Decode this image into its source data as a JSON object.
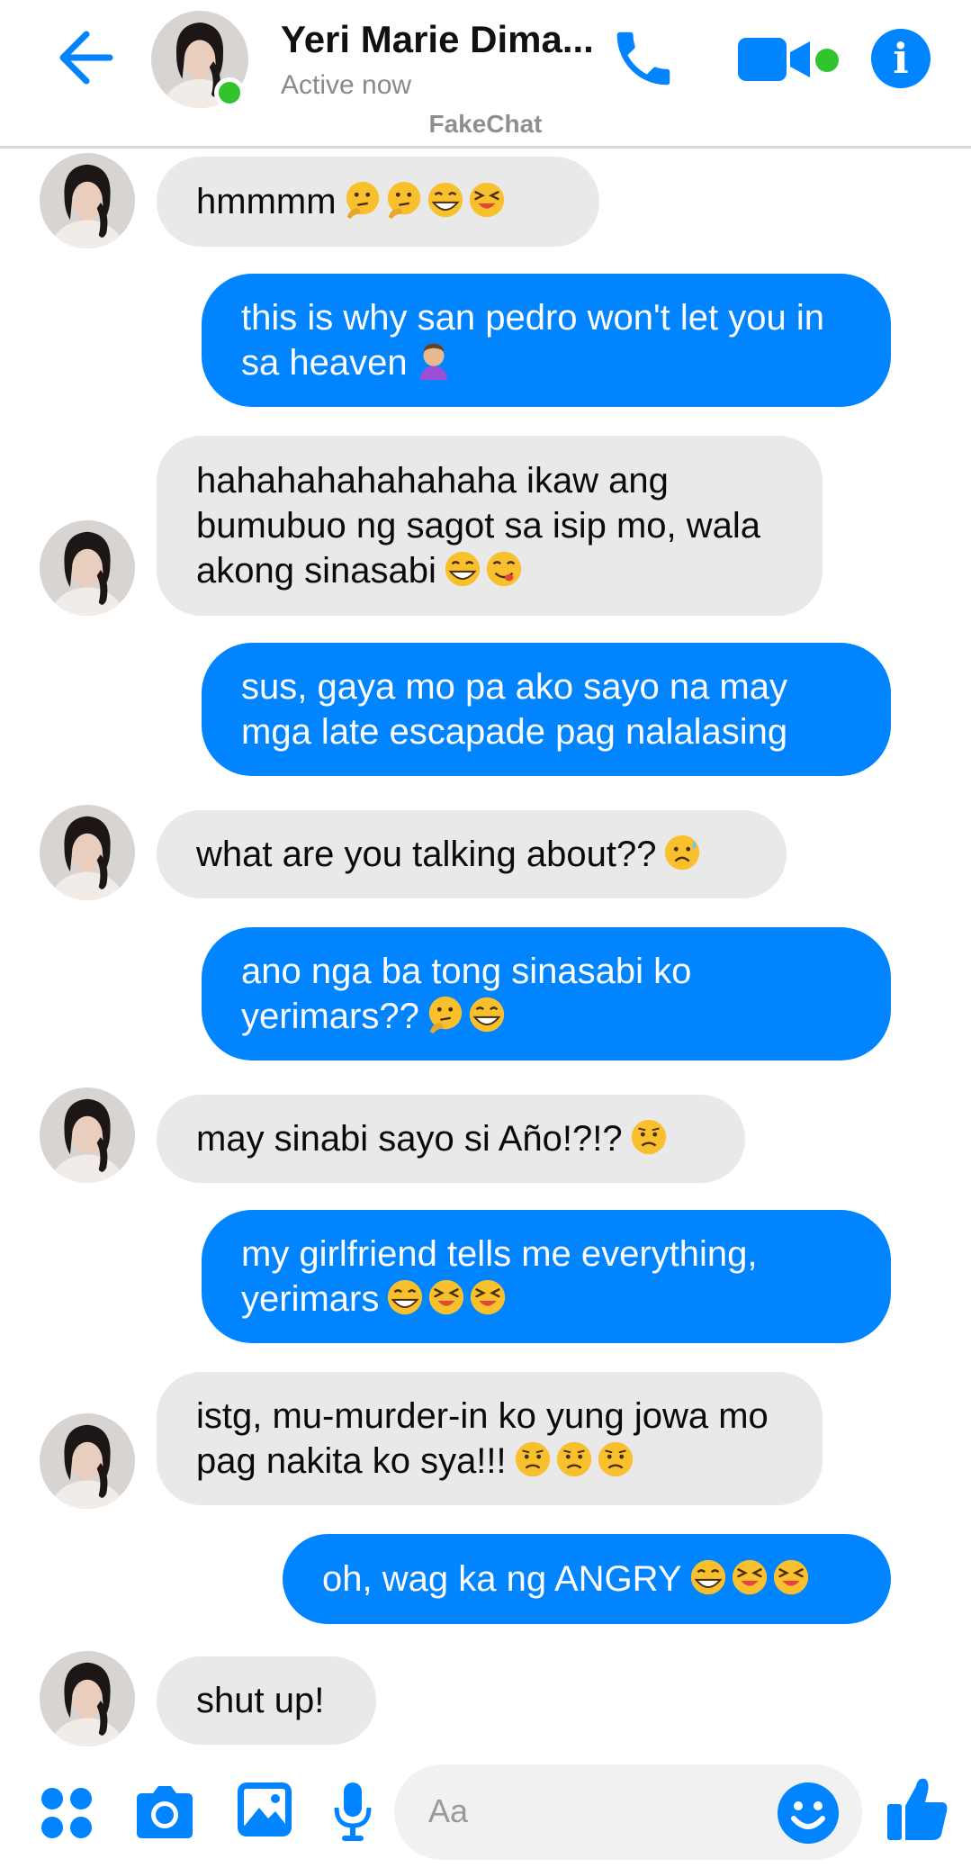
{
  "header": {
    "contact_name": "Yeri Marie Dima...",
    "status": "Active now",
    "watermark": "FakeChat"
  },
  "icons": {
    "back": "arrow-left-icon",
    "call": "phone-icon",
    "video": "video-camera-icon",
    "info": "info-icon",
    "apps": "four-dots-icon",
    "camera": "camera-icon",
    "gallery": "image-icon",
    "voice": "microphone-icon",
    "emoji": "smiley-icon",
    "like": "thumbs-up-icon"
  },
  "info_glyph": "i",
  "messages": [
    {
      "dir": "in",
      "text": "hmmmm",
      "emoji": [
        "thinking",
        "thinking",
        "grin-sweat",
        "squint"
      ]
    },
    {
      "dir": "out",
      "text": "this is why san pedro won't let you in sa heaven",
      "emoji": [
        "facepalm"
      ]
    },
    {
      "dir": "in",
      "text": "hahahahahahahaha ikaw ang bumubuo ng sagot sa isip mo, wala akong sinasabi",
      "emoji": [
        "grin-sweat",
        "yum"
      ]
    },
    {
      "dir": "out",
      "text": "sus, gaya mo pa ako sayo na may mga late escapade pag nalalasing",
      "emoji": []
    },
    {
      "dir": "in",
      "text": "what are you talking about??",
      "emoji": [
        "sad-sweat"
      ]
    },
    {
      "dir": "out",
      "text": "ano nga ba tong sinasabi ko yerimars??",
      "emoji": [
        "thinking",
        "grin-sweat"
      ]
    },
    {
      "dir": "in",
      "text": "may sinabi sayo si Año!?!?",
      "emoji": [
        "worried"
      ]
    },
    {
      "dir": "out",
      "text": "my girlfriend tells me everything, yerimars",
      "emoji": [
        "grin-sweat",
        "squint",
        "squint"
      ]
    },
    {
      "dir": "in",
      "text": "istg, mu-murder-in ko yung jowa mo pag nakita ko sya!!!",
      "emoji": [
        "worried",
        "worried",
        "worried"
      ]
    },
    {
      "dir": "out",
      "text": "oh, wag ka ng ANGRY",
      "emoji": [
        "grin-sweat",
        "squint",
        "squint"
      ]
    },
    {
      "dir": "in",
      "text": "shut up!",
      "emoji": []
    }
  ],
  "composer": {
    "placeholder": "Aa"
  },
  "colors": {
    "accent": "#0084ff",
    "online": "#31c42f",
    "received_bubble": "#e9e9e9",
    "emoji_yellow": "#f9c02e"
  }
}
